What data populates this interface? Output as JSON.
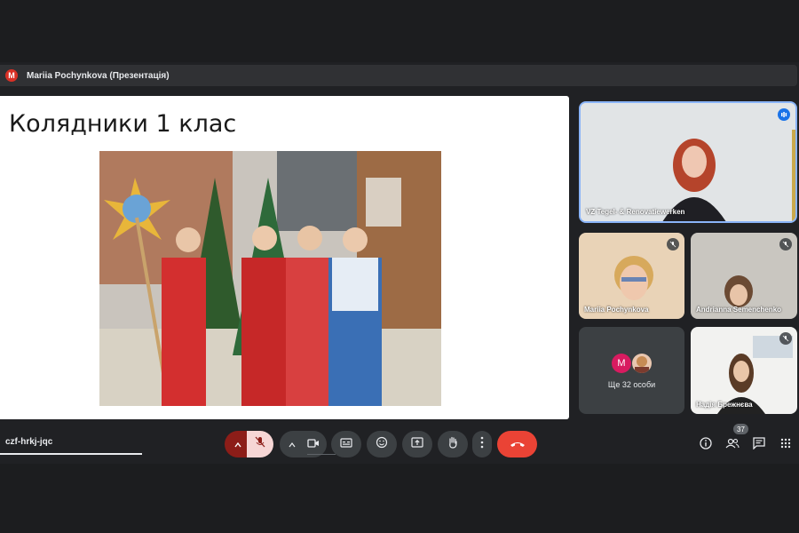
{
  "presenter": {
    "avatar_letter": "M",
    "label": "Mariia Pochynkova (Презентація)"
  },
  "slide": {
    "title": "Колядники 1 клас"
  },
  "participants": {
    "main": {
      "name": "VZ Tegel- & Renovatiewerken"
    },
    "tile1": {
      "name": "Mariia Pochynkova"
    },
    "tile2": {
      "name": "Andrianna Semenchenko"
    },
    "more": {
      "avatar_letter": "M",
      "label": "Ще 32 особи"
    },
    "tile4": {
      "name": "Надія Брежнєва"
    }
  },
  "controls": {
    "meeting_code": "czf-hrkj-jqc",
    "participants_count": "37"
  },
  "colors": {
    "end_call": "#ea4335",
    "mic_muted_bg": "#f6d6d5",
    "mic_arrow_bg": "#8c1d18",
    "speaking": "#1a73e8",
    "presenter_avatar": "#d93025"
  },
  "icons": [
    "chevron-up-icon",
    "mic-off-icon",
    "camera-icon",
    "captions-icon",
    "emoji-icon",
    "present-icon",
    "raise-hand-icon",
    "more-vert-icon",
    "end-call-icon",
    "info-icon",
    "people-icon",
    "chat-icon",
    "apps-icon"
  ]
}
